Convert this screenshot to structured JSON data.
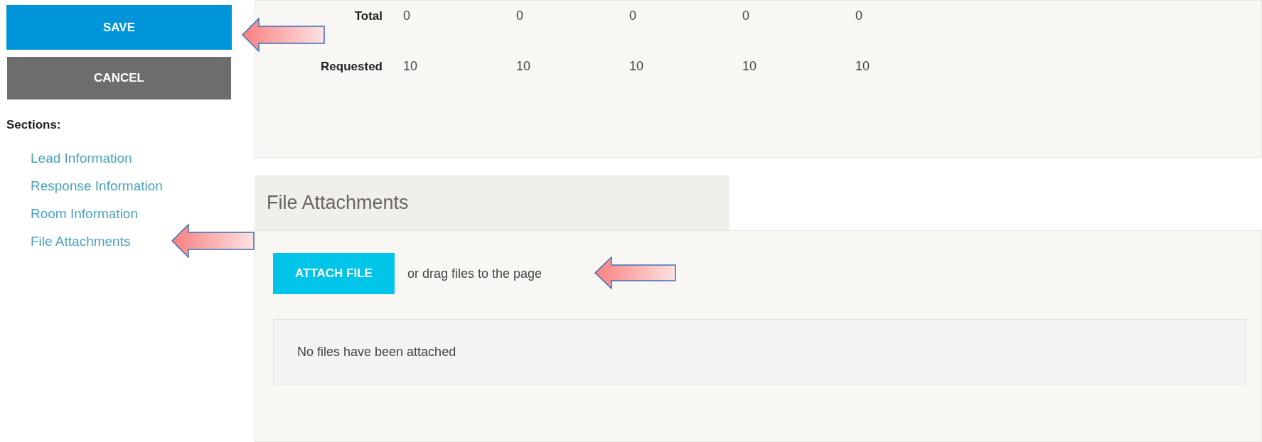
{
  "actions": {
    "save": "SAVE",
    "cancel": "CANCEL"
  },
  "sections": {
    "heading": "Sections:",
    "links": [
      "Lead Information",
      "Response Information",
      "Room Information",
      "File Attachments"
    ]
  },
  "totals": {
    "rows": [
      {
        "label": "Total",
        "values": [
          "0",
          "0",
          "0",
          "0",
          "0"
        ]
      },
      {
        "label": "Requested",
        "values": [
          "10",
          "10",
          "10",
          "10",
          "10"
        ]
      }
    ]
  },
  "file_attachments": {
    "title": "File Attachments",
    "attach_button": "ATTACH FILE",
    "hint": "or drag files to the page",
    "empty_message": "No files have been attached"
  }
}
